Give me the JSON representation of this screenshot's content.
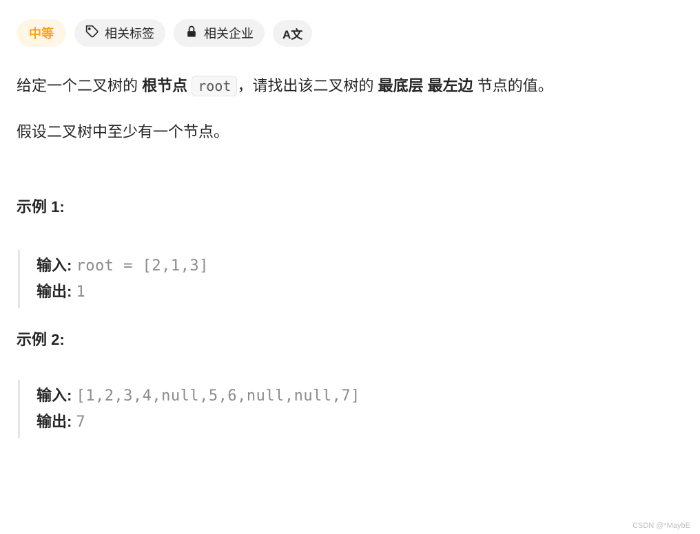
{
  "pills": {
    "difficulty": "中等",
    "tags": "相关标签",
    "companies": "相关企业",
    "translate": "A文"
  },
  "problem": {
    "line1_prefix": "给定一个二叉树的 ",
    "line1_bold1": "根节点",
    "line1_space": " ",
    "line1_code": "root",
    "line1_mid": "，请找出该二叉树的 ",
    "line1_bold2": "最底层 最左边 ",
    "line1_suffix": "节点的值。",
    "line2": "假设二叉树中至少有一个节点。"
  },
  "examples": {
    "title1": "示例 1:",
    "title2": "示例 2:",
    "input_label": "输入: ",
    "output_label": "输出: ",
    "ex1_input": "root = [2,1,3]",
    "ex1_output": "1",
    "ex2_input": "[1,2,3,4,null,5,6,null,null,7]",
    "ex2_output": "7"
  },
  "watermark": "CSDN @*MaybE"
}
